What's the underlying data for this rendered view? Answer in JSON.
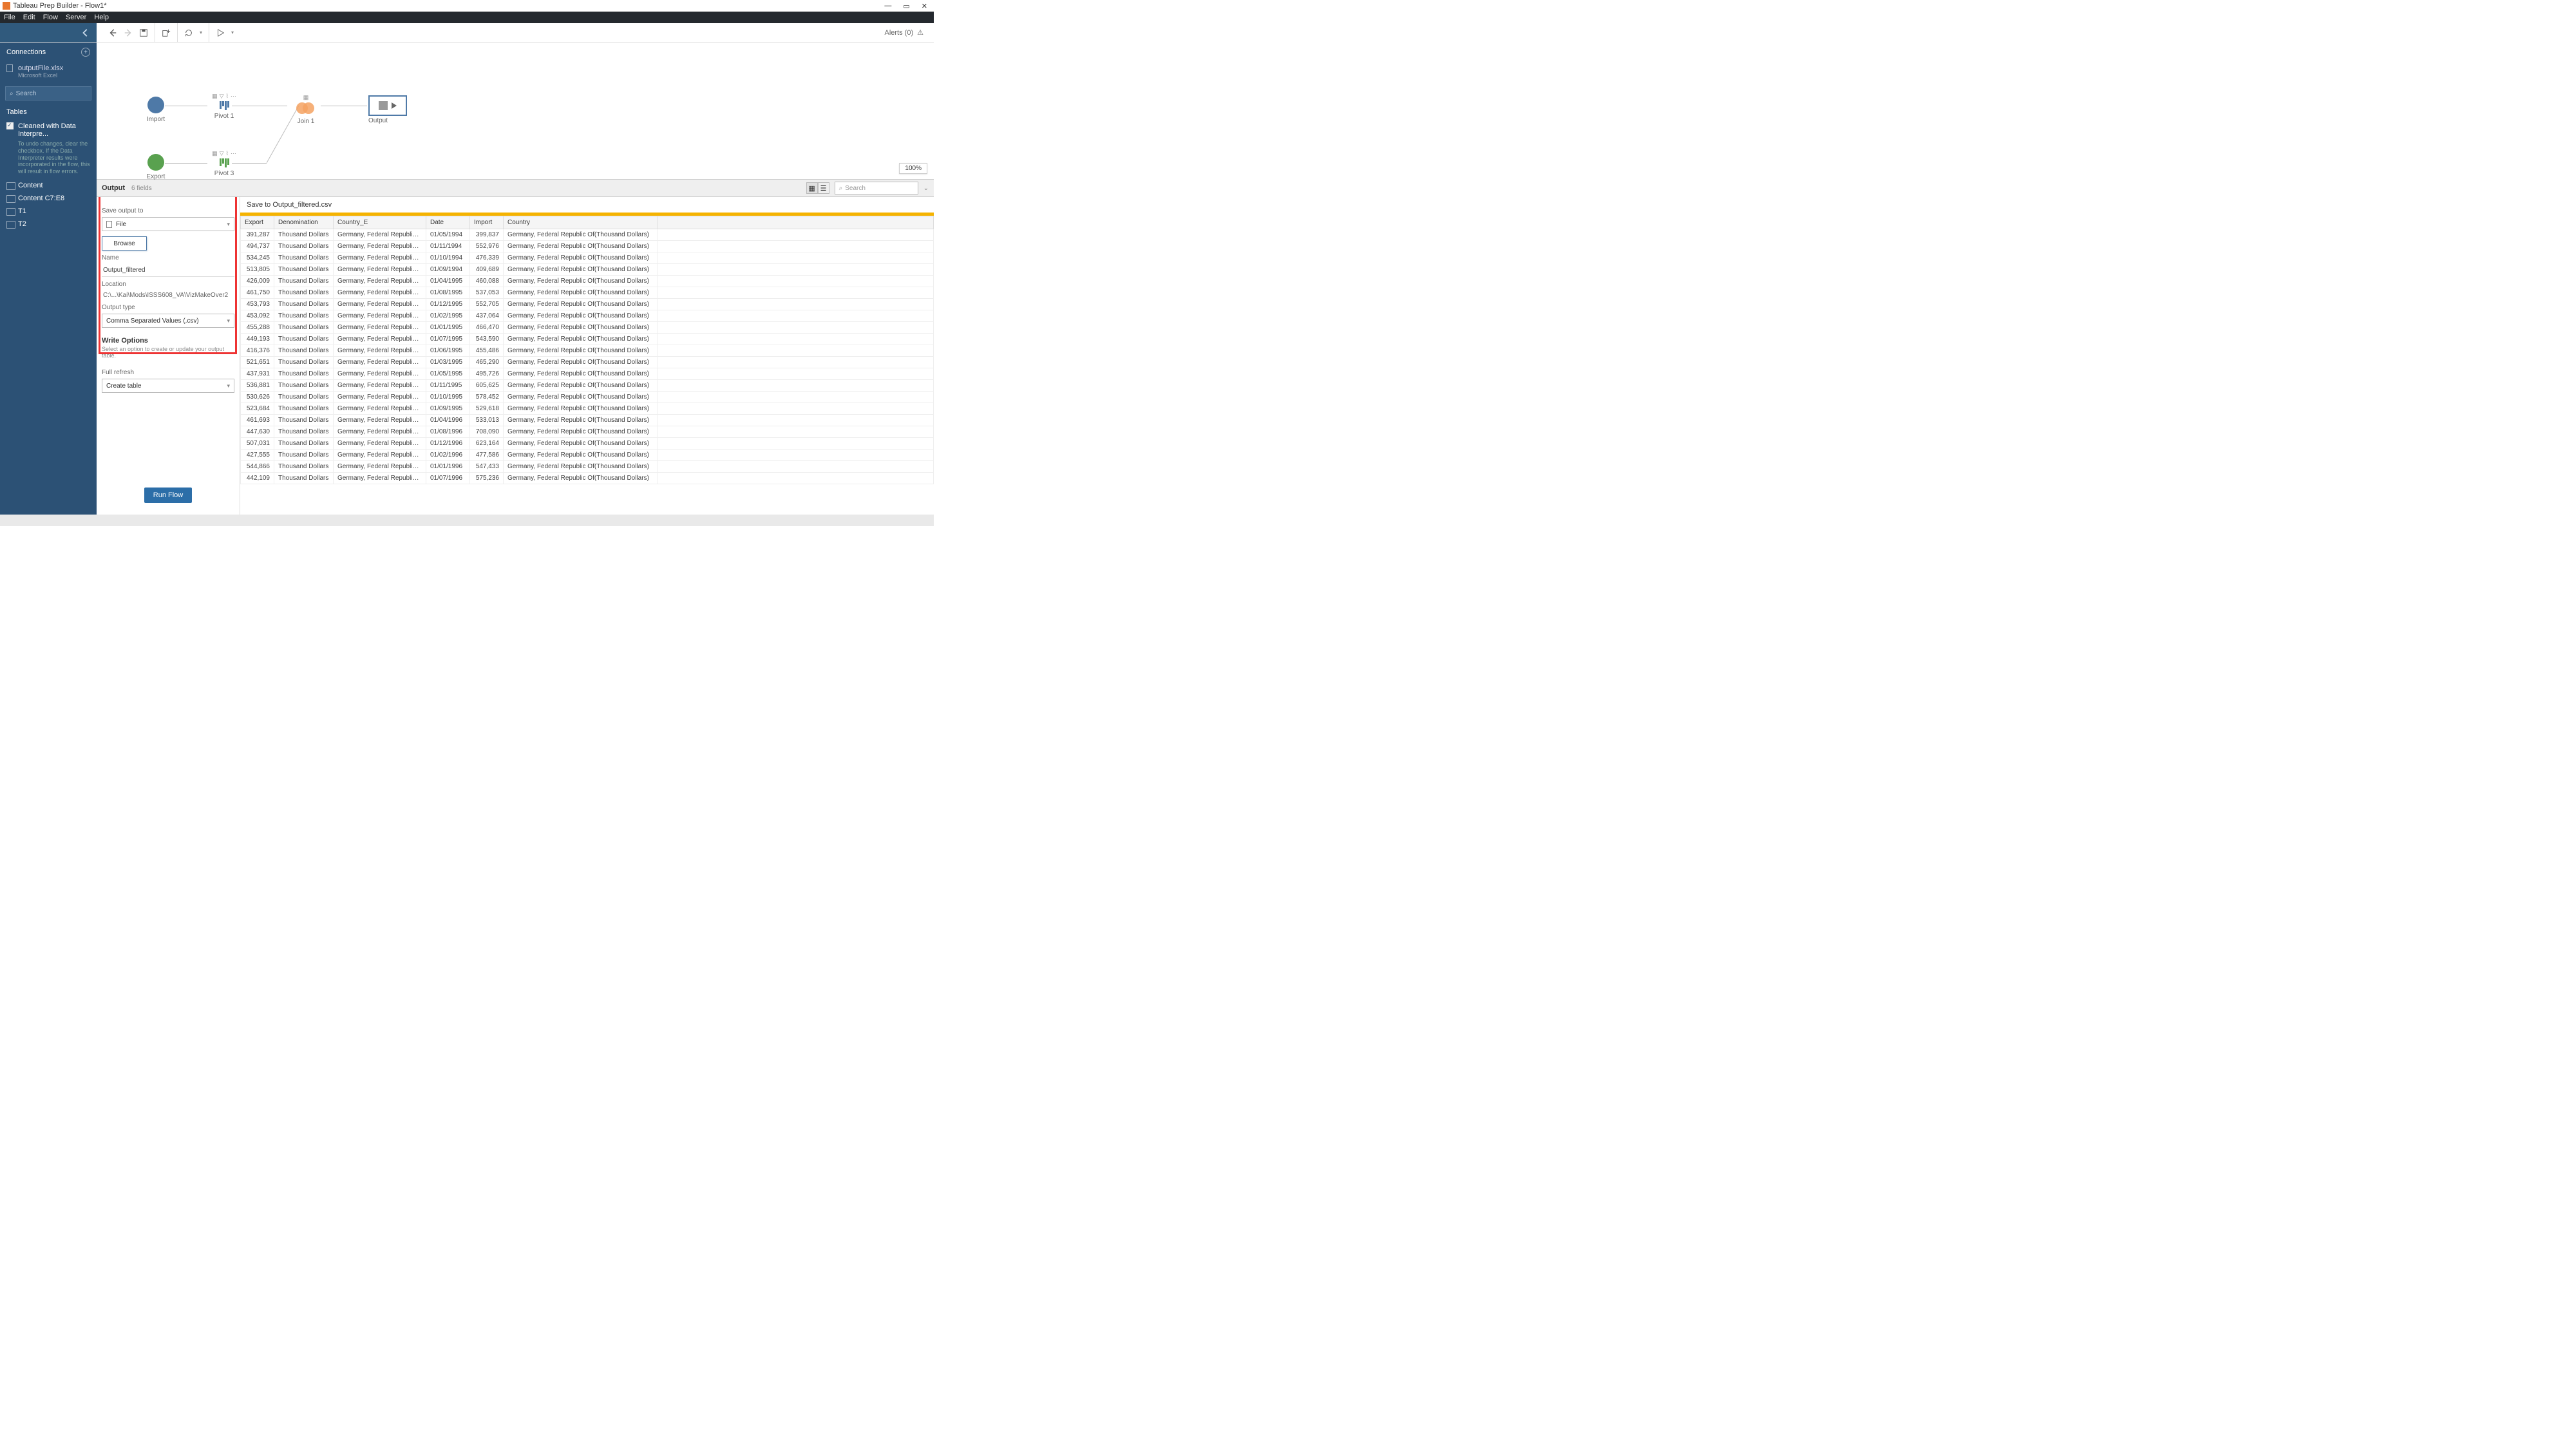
{
  "window": {
    "title": "Tableau Prep Builder - Flow1*"
  },
  "menubar": [
    "File",
    "Edit",
    "Flow",
    "Server",
    "Help"
  ],
  "toolbar": {
    "alerts_label": "Alerts (0)"
  },
  "sidebar": {
    "connections_label": "Connections",
    "connection": {
      "name": "outputFile.xlsx",
      "type": "Microsoft Excel"
    },
    "search_placeholder": "Search",
    "tables_label": "Tables",
    "interpreter_label": "Cleaned with Data Interpre...",
    "interpreter_note": "To undo changes, clear the checkbox. If the Data Interpreter results were incorporated in the flow, this will result in flow errors.",
    "items": [
      {
        "label": "Content"
      },
      {
        "label": "Content C7:E8"
      },
      {
        "label": "T1"
      },
      {
        "label": "T2"
      }
    ]
  },
  "canvas": {
    "nodes": {
      "import": "Import",
      "export": "Export",
      "pivot1": "Pivot 1",
      "pivot3": "Pivot 3",
      "join1": "Join 1",
      "output": "Output"
    },
    "zoom": "100%"
  },
  "detail": {
    "header_title": "Output",
    "header_sub": "6 fields",
    "search_placeholder": "Search",
    "left": {
      "save_to_label": "Save output to",
      "save_to_value": "File",
      "browse": "Browse",
      "name_label": "Name",
      "name_value": "Output_filtered",
      "location_label": "Location",
      "location_value": "C:\\...\\Kai\\Mods\\ISSS608_VA\\VizMakeOver2",
      "type_label": "Output type",
      "type_value": "Comma Separated Values (.csv)",
      "write_hdr": "Write Options",
      "write_note": "Select an option to create or update your output table.",
      "refresh_label": "Full refresh",
      "refresh_value": "Create table",
      "run": "Run Flow"
    },
    "right": {
      "save_header": "Save to Output_filtered.csv",
      "columns": [
        "Export",
        "Denomination",
        "Country_E",
        "Date",
        "Import",
        "Country"
      ],
      "rows": [
        [
          "391,287",
          "Thousand Dollars",
          "Germany, Federal Republic Of",
          "01/05/1994",
          "399,837",
          "Germany, Federal Republic Of(Thousand Dollars)"
        ],
        [
          "494,737",
          "Thousand Dollars",
          "Germany, Federal Republic Of",
          "01/11/1994",
          "552,976",
          "Germany, Federal Republic Of(Thousand Dollars)"
        ],
        [
          "534,245",
          "Thousand Dollars",
          "Germany, Federal Republic Of",
          "01/10/1994",
          "476,339",
          "Germany, Federal Republic Of(Thousand Dollars)"
        ],
        [
          "513,805",
          "Thousand Dollars",
          "Germany, Federal Republic Of",
          "01/09/1994",
          "409,689",
          "Germany, Federal Republic Of(Thousand Dollars)"
        ],
        [
          "426,009",
          "Thousand Dollars",
          "Germany, Federal Republic Of",
          "01/04/1995",
          "460,088",
          "Germany, Federal Republic Of(Thousand Dollars)"
        ],
        [
          "461,750",
          "Thousand Dollars",
          "Germany, Federal Republic Of",
          "01/08/1995",
          "537,053",
          "Germany, Federal Republic Of(Thousand Dollars)"
        ],
        [
          "453,793",
          "Thousand Dollars",
          "Germany, Federal Republic Of",
          "01/12/1995",
          "552,705",
          "Germany, Federal Republic Of(Thousand Dollars)"
        ],
        [
          "453,092",
          "Thousand Dollars",
          "Germany, Federal Republic Of",
          "01/02/1995",
          "437,064",
          "Germany, Federal Republic Of(Thousand Dollars)"
        ],
        [
          "455,288",
          "Thousand Dollars",
          "Germany, Federal Republic Of",
          "01/01/1995",
          "466,470",
          "Germany, Federal Republic Of(Thousand Dollars)"
        ],
        [
          "449,193",
          "Thousand Dollars",
          "Germany, Federal Republic Of",
          "01/07/1995",
          "543,590",
          "Germany, Federal Republic Of(Thousand Dollars)"
        ],
        [
          "416,376",
          "Thousand Dollars",
          "Germany, Federal Republic Of",
          "01/06/1995",
          "455,486",
          "Germany, Federal Republic Of(Thousand Dollars)"
        ],
        [
          "521,651",
          "Thousand Dollars",
          "Germany, Federal Republic Of",
          "01/03/1995",
          "465,290",
          "Germany, Federal Republic Of(Thousand Dollars)"
        ],
        [
          "437,931",
          "Thousand Dollars",
          "Germany, Federal Republic Of",
          "01/05/1995",
          "495,726",
          "Germany, Federal Republic Of(Thousand Dollars)"
        ],
        [
          "536,881",
          "Thousand Dollars",
          "Germany, Federal Republic Of",
          "01/11/1995",
          "605,625",
          "Germany, Federal Republic Of(Thousand Dollars)"
        ],
        [
          "530,626",
          "Thousand Dollars",
          "Germany, Federal Republic Of",
          "01/10/1995",
          "578,452",
          "Germany, Federal Republic Of(Thousand Dollars)"
        ],
        [
          "523,684",
          "Thousand Dollars",
          "Germany, Federal Republic Of",
          "01/09/1995",
          "529,618",
          "Germany, Federal Republic Of(Thousand Dollars)"
        ],
        [
          "461,693",
          "Thousand Dollars",
          "Germany, Federal Republic Of",
          "01/04/1996",
          "533,013",
          "Germany, Federal Republic Of(Thousand Dollars)"
        ],
        [
          "447,630",
          "Thousand Dollars",
          "Germany, Federal Republic Of",
          "01/08/1996",
          "708,090",
          "Germany, Federal Republic Of(Thousand Dollars)"
        ],
        [
          "507,031",
          "Thousand Dollars",
          "Germany, Federal Republic Of",
          "01/12/1996",
          "623,164",
          "Germany, Federal Republic Of(Thousand Dollars)"
        ],
        [
          "427,555",
          "Thousand Dollars",
          "Germany, Federal Republic Of",
          "01/02/1996",
          "477,586",
          "Germany, Federal Republic Of(Thousand Dollars)"
        ],
        [
          "544,866",
          "Thousand Dollars",
          "Germany, Federal Republic Of",
          "01/01/1996",
          "547,433",
          "Germany, Federal Republic Of(Thousand Dollars)"
        ],
        [
          "442,109",
          "Thousand Dollars",
          "Germany, Federal Republic Of",
          "01/07/1996",
          "575,236",
          "Germany, Federal Republic Of(Thousand Dollars)"
        ]
      ]
    }
  }
}
